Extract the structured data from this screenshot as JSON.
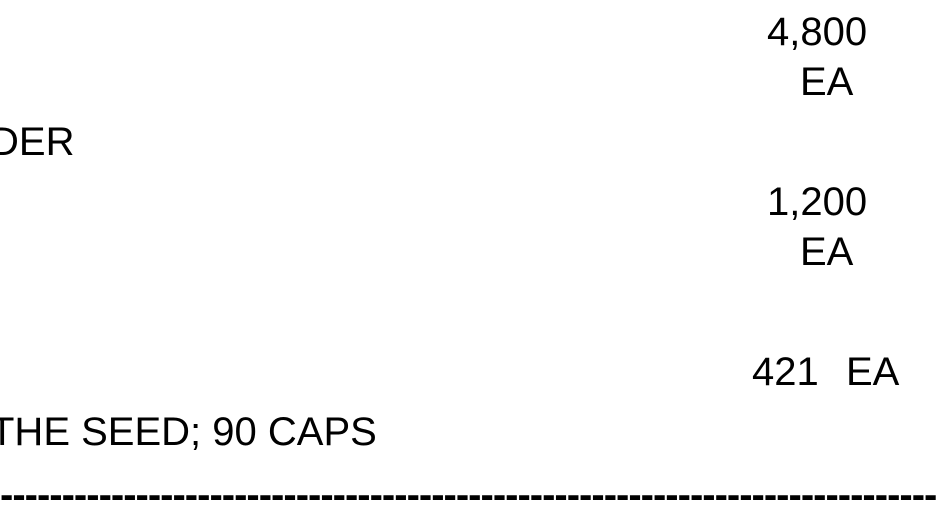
{
  "items": [
    {
      "quantity": "4,800",
      "unit": "EA"
    },
    {
      "description": "DER"
    },
    {
      "quantity": "1,200",
      "unit": "EA"
    },
    {
      "quantity": "421",
      "unit": "EA"
    },
    {
      "description": "THE SEED; 90 CAPS"
    }
  ],
  "separator": "----------------------------------------------------------------------------"
}
